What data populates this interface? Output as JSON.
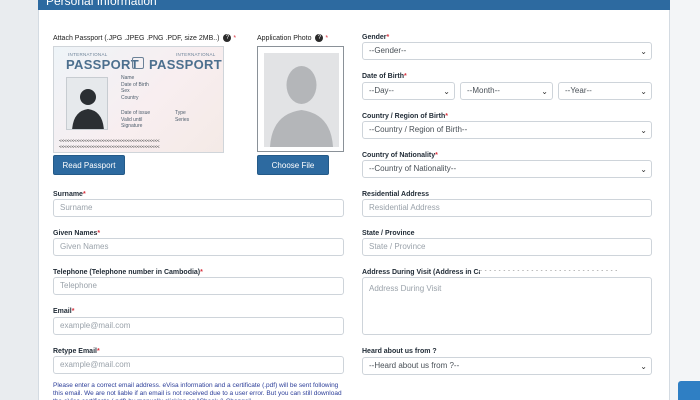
{
  "header": {
    "title": "Personal Information"
  },
  "passport_section": {
    "label": "Attach Passport (.JPG .JPEG .PNG .PDF, size 2MB..)",
    "required_mark": "*",
    "help_mark": "?",
    "sample": {
      "small_left": "INTERNATIONAL",
      "title_left": "PASSPORT",
      "small_right": "INTERNATIONAL",
      "title_right": "PASSPORT",
      "fields_top": [
        "Name",
        "Date of Birth",
        "Sex",
        "Country"
      ],
      "fields_bottom_left": [
        "Date of issue",
        "Valid until",
        "Signature"
      ],
      "fields_bottom_right": [
        "Type",
        "Series"
      ],
      "mrz_line1": "<<<<<<<<<<<<<<<<<<<<<<<<<<<<<<<<<<<<<<<<",
      "mrz_line2": "<<<<<<<<<<<<<<<<<<<<<<<<<<<<<<<<<<<<<<<<"
    },
    "button_label": "Read Passport"
  },
  "photo_section": {
    "label": "Application Photo",
    "help_mark": "?",
    "required_mark": "*",
    "button_label": "Choose File"
  },
  "left_fields": [
    {
      "label": "Surname",
      "required_mark": "*",
      "placeholder": "Surname"
    },
    {
      "label": "Given Names",
      "required_mark": "*",
      "placeholder": "Given Names"
    },
    {
      "label": "Telephone (Telephone number in Cambodia)",
      "required_mark": "*",
      "placeholder": "Telephone"
    },
    {
      "label": "Email",
      "required_mark": "*",
      "placeholder": "example@mail.com"
    },
    {
      "label": "Retype Email",
      "required_mark": "*",
      "placeholder": "example@mail.com"
    }
  ],
  "note": "Please enter a correct email address. eVisa information and a certificate (.pdf) will be sent following this email. We are not liable if an email is not received due to a user error. But you can still download the eVisa certificate (.pdf) by manually clicking on \"Check & Change\".",
  "right_fields": {
    "gender": {
      "label": "Gender",
      "required_mark": "*",
      "value": "--Gender--"
    },
    "dob": {
      "label": "Date of Birth",
      "required_mark": "*",
      "day": "--Day--",
      "month": "--Month--",
      "year": "--Year--"
    },
    "country_birth": {
      "label": "Country / Region of Birth",
      "required_mark": "*",
      "value": "--Country / Region of Birth--"
    },
    "nationality": {
      "label": "Country of Nationality",
      "required_mark": "*",
      "value": "--Country of Nationality--"
    },
    "residential": {
      "label": "Residential Address",
      "placeholder": "Residential Address"
    },
    "state": {
      "label": "State / Province",
      "placeholder": "State / Province"
    },
    "visit_address": {
      "label": "Address During Visit (Address in Camb",
      "placeholder": "Address During Visit"
    },
    "heard": {
      "label": "Heard about us from ?",
      "value": "--Heard about us from ?--"
    }
  }
}
